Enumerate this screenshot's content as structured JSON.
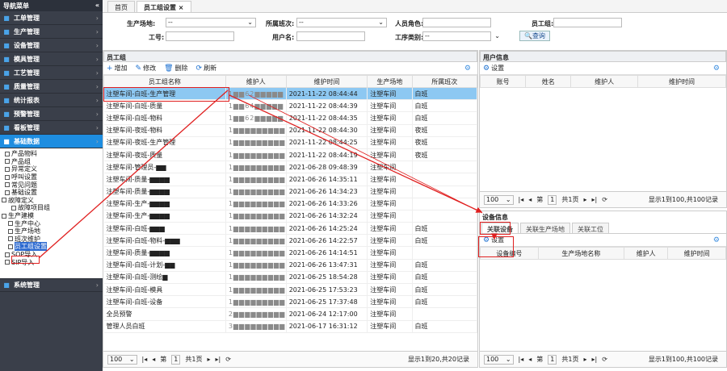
{
  "sidebar": {
    "title": "导航菜单",
    "collapse": "«",
    "menu": [
      {
        "label": "工单管理",
        "icon": "clipboard-icon"
      },
      {
        "label": "生产管理",
        "icon": "gear-icon"
      },
      {
        "label": "设备管理",
        "icon": "bars-icon"
      },
      {
        "label": "模具管理",
        "icon": "mold-icon"
      },
      {
        "label": "工艺管理",
        "icon": "flow-icon"
      },
      {
        "label": "质量管理",
        "icon": "shield-icon"
      },
      {
        "label": "统计报表",
        "icon": "chart-icon"
      },
      {
        "label": "预警管理",
        "icon": "bell-icon"
      },
      {
        "label": "看板管理",
        "icon": "monitor-icon"
      },
      {
        "label": "基础数据",
        "icon": "database-icon"
      }
    ],
    "tree": [
      "产品物料",
      "产品组",
      "异常定义",
      "呼叫设置",
      "常见问题",
      "基础设置",
      "故障定义",
      "故障项目组",
      "生产建模",
      "生产中心",
      "生产场地",
      "班次维护",
      "员工组设置",
      "SOP导入",
      "SIP导入"
    ],
    "system": "系统管理"
  },
  "tabs": [
    "首页",
    "员工组设置 ×"
  ],
  "filter": {
    "site_label": "生产场地:",
    "site_value": "--",
    "shift_label": "所属班次:",
    "shift_value": "--",
    "role_label": "人员角色:",
    "group_label": "员工组:",
    "no_label": "工号:",
    "user_label": "用户名:",
    "proc_label": "工序类别:",
    "proc_value": "--",
    "query": "查询"
  },
  "left": {
    "title": "员工组",
    "buttons": [
      "增加",
      "修改",
      "删除",
      "刷新"
    ],
    "headers": [
      "员工组名称",
      "维护人",
      "维护时间",
      "生产场地",
      "所属班次"
    ],
    "rows": [
      [
        "注塑车间-白班-生产管理",
        "1▆▆62▆▆▆▆▆",
        "2021-11-22 08:44:44",
        "注塑车间",
        "白班"
      ],
      [
        "注塑车间-白班-质量",
        "1▆▆64▆▆▆▆▆",
        "2021-11-22 08:44:39",
        "注塑车间",
        "白班"
      ],
      [
        "注塑车间-白班-物料",
        "1▆▆62▆▆▆▆▆",
        "2021-11-22 08:44:35",
        "注塑车间",
        "白班"
      ],
      [
        "注塑车间-夜班-物料",
        "1▆▆▆▆▆▆▆▆▆",
        "2021-11-22 08:44:30",
        "注塑车间",
        "夜班"
      ],
      [
        "注塑车间-夜班-生产管理",
        "1▆▆▆▆▆▆▆▆▆",
        "2021-11-22 08:44:25",
        "注塑车间",
        "夜班"
      ],
      [
        "注塑车间-夜班-质量",
        "1▆▆▆▆▆▆▆▆▆",
        "2021-11-22 08:44:19",
        "注塑车间",
        "夜班"
      ],
      [
        "注塑车间-管理员-▆▆",
        "1▆▆▆▆▆▆▆▆▆",
        "2021-06-28 09:48:39",
        "注塑车间",
        ""
      ],
      [
        "注塑车间-质量-▆▆▆▆",
        "1▆▆▆▆▆▆▆▆▆",
        "2021-06-26 14:35:11",
        "注塑车间",
        ""
      ],
      [
        "注塑车间-质量-▆▆▆▆",
        "1▆▆▆▆▆▆▆▆▆",
        "2021-06-26 14:34:23",
        "注塑车间",
        ""
      ],
      [
        "注塑车间-生产-▆▆▆▆",
        "1▆▆▆▆▆▆▆▆▆",
        "2021-06-26 14:33:26",
        "注塑车间",
        ""
      ],
      [
        "注塑车间-生产-▆▆▆▆",
        "1▆▆▆▆▆▆▆▆▆",
        "2021-06-26 14:32:24",
        "注塑车间",
        ""
      ],
      [
        "注塑车间-白班-▆▆▆",
        "1▆▆▆▆▆▆▆▆▆",
        "2021-06-26 14:25:24",
        "注塑车间",
        "白班"
      ],
      [
        "注塑车间-白班-物料-▆▆▆",
        "1▆▆▆▆▆▆▆▆▆",
        "2021-06-26 14:22:57",
        "注塑车间",
        "白班"
      ],
      [
        "注塑车间-质量-▆▆▆▆",
        "1▆▆▆▆▆▆▆▆▆",
        "2021-06-26 14:14:51",
        "注塑车间",
        ""
      ],
      [
        "注塑车间-白班-计划-▆▆",
        "1▆▆▆▆▆▆▆▆▆",
        "2021-06-26 13:47:31",
        "注塑车间",
        "白班"
      ],
      [
        "注塑车间-白班-测绘▆",
        "1▆▆▆▆▆▆▆▆▆",
        "2021-06-25 18:54:28",
        "注塑车间",
        "白班"
      ],
      [
        "注塑车间-白班-模具",
        "1▆▆▆▆▆▆▆▆▆",
        "2021-06-25 17:53:23",
        "注塑车间",
        "白班"
      ],
      [
        "注塑车间-白班-设备",
        "1▆▆▆▆▆▆▆▆▆",
        "2021-06-25 17:37:48",
        "注塑车间",
        "白班"
      ],
      [
        "全员预警",
        "2▆▆▆▆▆▆▆▆▆",
        "2021-06-24 12:17:00",
        "注塑车间",
        ""
      ],
      [
        "管理人员白班",
        "3▆▆▆▆▆▆▆▆▆",
        "2021-06-17 16:31:12",
        "注塑车间",
        "白班"
      ]
    ],
    "pager": {
      "size": "100",
      "page_label": "第",
      "page": "1",
      "total": "共1页",
      "info": "显示1到20,共20记录"
    }
  },
  "user_info": {
    "title": "用户信息",
    "setting": "设置",
    "headers": [
      "账号",
      "姓名",
      "维护人",
      "维护时间"
    ],
    "pager": {
      "size": "100",
      "page_label": "第",
      "page": "1",
      "total": "共1页",
      "info": "显示1到100,共100记录"
    }
  },
  "device_info": {
    "title": "设备信息",
    "subtabs": [
      "关联设备",
      "关联生产场地",
      "关联工位"
    ],
    "setting": "设置",
    "headers": [
      "设备编号",
      "生产场地名称",
      "维护人",
      "维护时间"
    ],
    "pager": {
      "size": "100",
      "page_label": "第",
      "page": "1",
      "total": "共1页",
      "info": "显示1到100,共100记录"
    }
  },
  "colors": {
    "sidebar": "#3a3f4a",
    "active": "#1e8de0",
    "selected_row": "#8dc8f2",
    "highlight": "#e02020"
  }
}
